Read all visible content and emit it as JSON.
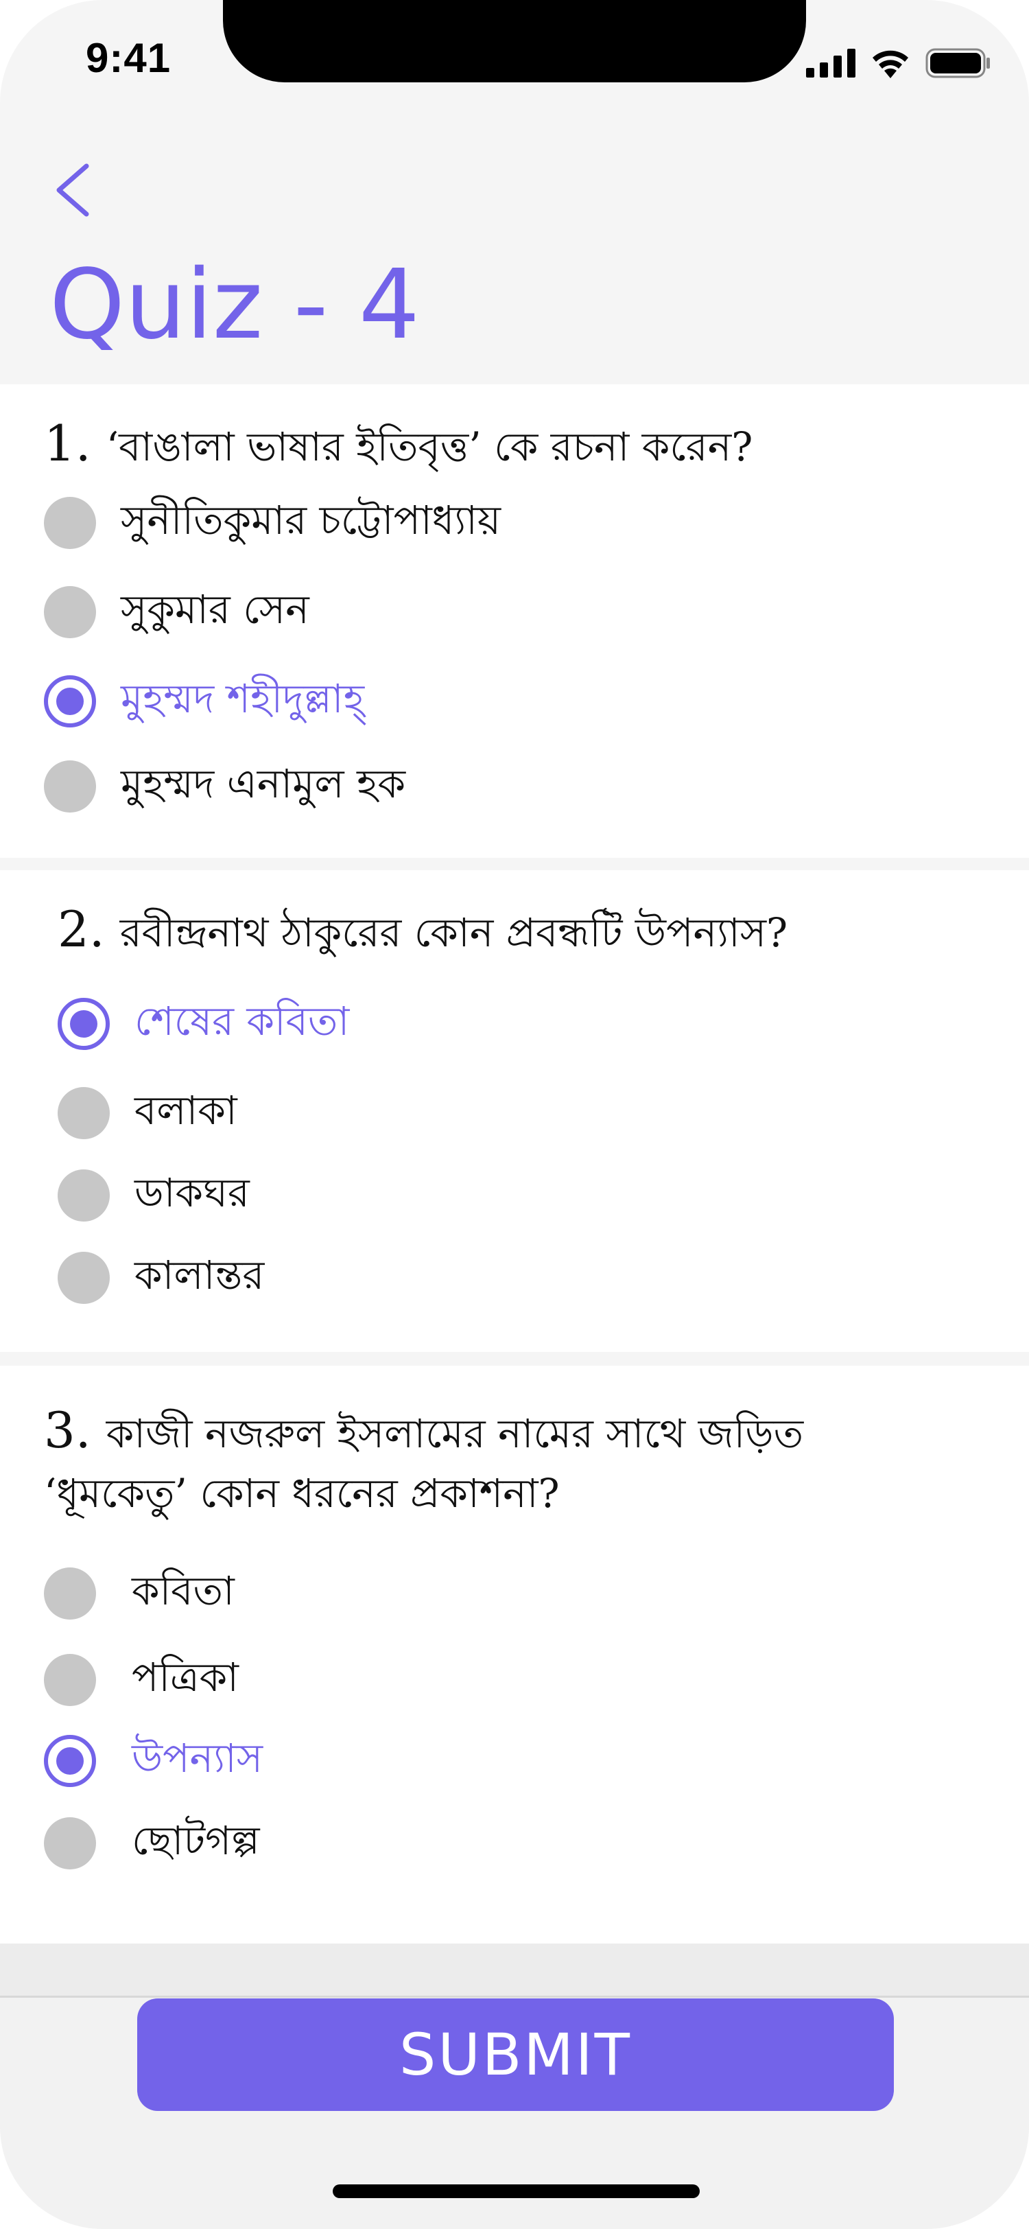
{
  "status_bar": {
    "time": "9:41",
    "icons": [
      "cellular-signal-icon",
      "wifi-icon",
      "battery-icon"
    ]
  },
  "header": {
    "back_icon": "chevron-left-icon",
    "title": "Quiz - 4"
  },
  "questions": [
    {
      "number": "1.",
      "text_lines": [
        "‘বাঙালা ভাষার ইতিবৃত্ত’ কে রচনা করেন?"
      ],
      "options": [
        {
          "label": "সুনীতিকুমার চট্টোপাধ্যায়",
          "selected": false
        },
        {
          "label": "সুকুমার সেন",
          "selected": false
        },
        {
          "label": "মুহম্মদ শহীদুল্লাহ্",
          "selected": true
        },
        {
          "label": "মুহম্মদ এনামুল হক",
          "selected": false
        }
      ]
    },
    {
      "number": "2.",
      "text_lines": [
        "রবীন্দ্রনাথ ঠাকুরের কোন প্রবন্ধটি উপন্যাস?"
      ],
      "options": [
        {
          "label": "শেষের কবিতা",
          "selected": true
        },
        {
          "label": "বলাকা",
          "selected": false
        },
        {
          "label": "ডাকঘর",
          "selected": false
        },
        {
          "label": "কালান্তর",
          "selected": false
        }
      ]
    },
    {
      "number": "3.",
      "text_lines": [
        "কাজী নজরুল ইসলামের নামের সাথে জড়িত",
        "‘ধূমকেতু’ কোন ধরনের প্রকাশনা?"
      ],
      "options": [
        {
          "label": "কবিতা",
          "selected": false
        },
        {
          "label": "পত্রিকা",
          "selected": false
        },
        {
          "label": "উপন্যাস",
          "selected": true
        },
        {
          "label": "ছোটগল্প",
          "selected": false
        }
      ]
    }
  ],
  "submit": {
    "label": "SUBMIT"
  },
  "colors": {
    "accent": "#7363e9",
    "unselected_radio": "#c7c7c7",
    "text": "#111111"
  }
}
